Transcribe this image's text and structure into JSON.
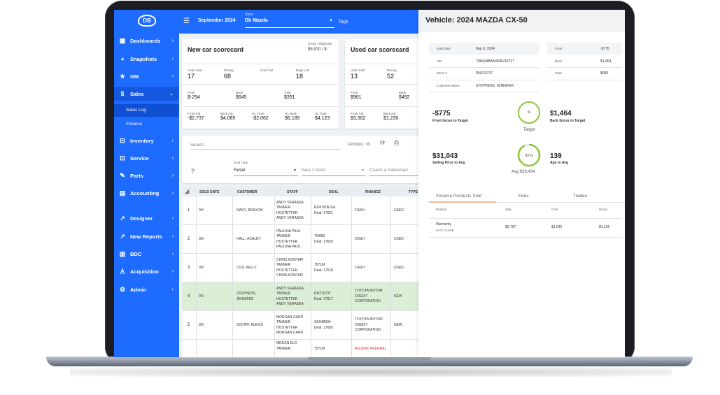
{
  "colors": {
    "brand_blue": "#1e6bff",
    "highlight_row": "#dcefd6",
    "gauge_green": "#8dc63f",
    "error_red": "#d42b2b"
  },
  "sidebar": {
    "logo": "DB",
    "items": [
      {
        "label": "Dashboards",
        "icon": "dashboard-icon"
      },
      {
        "label": "Snapshots",
        "icon": "pie-icon"
      },
      {
        "label": "GM",
        "icon": "star-icon"
      },
      {
        "label": "Sales",
        "icon": "dollar-icon"
      },
      {
        "label": "Inventory",
        "icon": "car-icon"
      },
      {
        "label": "Service",
        "icon": "car-service-icon"
      },
      {
        "label": "Parts",
        "icon": "wrench-icon"
      },
      {
        "label": "Accounting",
        "icon": "calculator-icon"
      },
      {
        "label": "Designer",
        "icon": "trend-icon"
      },
      {
        "label": "New Reports",
        "icon": "trend-icon"
      },
      {
        "label": "BDC",
        "icon": "map-icon"
      },
      {
        "label": "Acquisition",
        "icon": "person-icon"
      },
      {
        "label": "Admin",
        "icon": "gear-icon"
      }
    ],
    "sub_items": [
      {
        "label": "Sales Log"
      },
      {
        "label": "Finance"
      }
    ]
  },
  "topbar": {
    "month": "September 2024",
    "store_label": "Store",
    "store_value": "Db Mazda",
    "tags_label": "Tags"
  },
  "new_car_scorecard": {
    "title": "New car scorecard",
    "gross_label": "Gross / Objective",
    "gross_value": "$5,970 / $",
    "row1": [
      {
        "label": "Units Sold",
        "value": "17"
      },
      {
        "label": "Pacing",
        "value": "68"
      },
      {
        "label": "Unit Cost",
        "value": ""
      },
      {
        "label": "Days Left",
        "value": "18"
      }
    ],
    "row2": [
      {
        "label": "Front",
        "value": "$-294"
      },
      {
        "label": "Back",
        "value": "$645"
      },
      {
        "label": "Total",
        "value": "$351"
      }
    ],
    "row3": [
      {
        "label": "Front Adj.",
        "value": "-$2,737"
      },
      {
        "label": "Back Adj.",
        "value": "$4,065"
      },
      {
        "label": "GL Front",
        "value": "-$2,062"
      },
      {
        "label": "GL Back",
        "value": "$6,185"
      },
      {
        "label": "GL Total",
        "value": "$4,123"
      }
    ]
  },
  "used_car_scorecard": {
    "title": "Used car scorecard",
    "row1": [
      {
        "label": "Units Sold",
        "value": "13"
      },
      {
        "label": "Pacing",
        "value": "52"
      }
    ],
    "row2": [
      {
        "label": "Front",
        "value": "$901"
      },
      {
        "label": "Back",
        "value": "$492"
      }
    ],
    "row3": [
      {
        "label": "Front Adj.",
        "value": "$3,302"
      },
      {
        "label": "Back Adj.",
        "value": "$1,230"
      }
    ]
  },
  "search": {
    "placeholder": "Search",
    "vehicles_label": "Vehicles: 30",
    "deal_type_label": "Deal Type",
    "deal_type_value": "Retail",
    "new_used_placeholder": "New / Used",
    "coach_placeholder": "Coach a Salesman"
  },
  "table": {
    "columns": [
      "SOLD DATE",
      "CUSTOMER",
      "STAFF",
      "DEAL",
      "FINANCE",
      "TYPE"
    ],
    "rows": [
      {
        "num": "1",
        "date": "9/9",
        "customer": [
          "RAYO, BRAXON"
        ],
        "staff": [
          "ANDY VERASKA",
          "TANNER",
          "HOSTETTER",
          "ANDY VERASKA"
        ],
        "deal": [
          "RO4760519A",
          "Deal: 17621"
        ],
        "finance": [
          "CASH"
        ],
        "type": "USED",
        "highlight": false
      },
      {
        "num": "2",
        "date": "9/9",
        "customer": [
          "HALL, ASHLEY"
        ],
        "staff": [
          "PAULINA PAUL",
          "TANNER",
          "HOSTETTER",
          "PAULINA PAUL"
        ],
        "deal": [
          "7548M",
          "Deal: 17620"
        ],
        "finance": [
          "CASH"
        ],
        "type": "USED",
        "highlight": false
      },
      {
        "num": "3",
        "date": "9/9",
        "customer": [
          "COX, KELLY"
        ],
        "staff": [
          "CHRIS KONTAPI",
          "TANNER",
          "HOSTETTER",
          "CHRIS KONTAPI"
        ],
        "deal": [
          "7571M",
          "Deal: 17618"
        ],
        "finance": [
          "CASH"
        ],
        "type": "USED",
        "highlight": false
      },
      {
        "num": "4",
        "date": "9/9",
        "customer": [
          "STEPHENS,",
          "JENNIFER"
        ],
        "staff": [
          "ANDY VERASKA",
          "TANNER",
          "HOSTETTER",
          "ANDY VERASKA"
        ],
        "deal": [
          "RN219737",
          "Deal: 17617"
        ],
        "finance": [
          "TOYOTA MOTOR",
          "CREDIT",
          "CORPORATION"
        ],
        "type": "NEW",
        "highlight": true
      },
      {
        "num": "5",
        "date": "9/9",
        "customer": [
          "SCHIPP, ALEXIS"
        ],
        "staff": [
          "MORGAN CARR",
          "TANNER",
          "HOSTETTER",
          "MORGAN CARR"
        ],
        "deal": [
          "SD048994",
          "Deal: 17605"
        ],
        "finance": [
          "TOYOTA MOTOR",
          "CREDIT",
          "CORPORATION"
        ],
        "type": "NEW",
        "highlight": false
      },
      {
        "num": "",
        "date": "",
        "customer": [],
        "staff": [
          "MEGAN ELD",
          "TANNER"
        ],
        "deal": [
          "7571M"
        ],
        "finance": [
          "ASCEND FEDERAL"
        ],
        "type": "",
        "highlight": false
      }
    ]
  },
  "vehicle": {
    "title": "Vehicle: 2024 MAZDA CX-50",
    "info": [
      {
        "label": "Sold Date",
        "value": "Sep 9, 2024"
      },
      {
        "label": "VIN",
        "value": "7MMVABAM4RN219737"
      },
      {
        "label": "Stock #",
        "value": "RN219737"
      },
      {
        "label": "Customer Name",
        "value": "STEPHENS, JENNIFER"
      }
    ],
    "gross": [
      {
        "label": "Front",
        "value": "-$775"
      },
      {
        "label": "Back",
        "value": "$1,464"
      },
      {
        "label": "Total",
        "value": "$689"
      }
    ],
    "front_gross_value": "-$775",
    "front_gross_label": "Front Gross to Target",
    "back_gross_value": "$1,464",
    "back_gross_label": "Back Gross to Target",
    "target_gauge_pct": "%",
    "target_caption": "Target",
    "selling_price_value": "$31,043",
    "selling_price_label": "Selling Price to Avg",
    "avg_gauge_pct": "93 %",
    "avg_gauge_value": 0.93,
    "avg_caption": "Avg $33,434",
    "age_value": "139",
    "age_label": "Age to Avg",
    "tabs": [
      "Finance Products Sold",
      "Fees",
      "Trades"
    ],
    "products_columns": [
      "Product",
      "Sale",
      "Cost",
      "Gross"
    ],
    "products": [
      {
        "name": "Warranty",
        "vendor": "EASY CARE",
        "sale": "$2,707",
        "cost": "$1,542",
        "gross": "$1,165"
      }
    ]
  }
}
